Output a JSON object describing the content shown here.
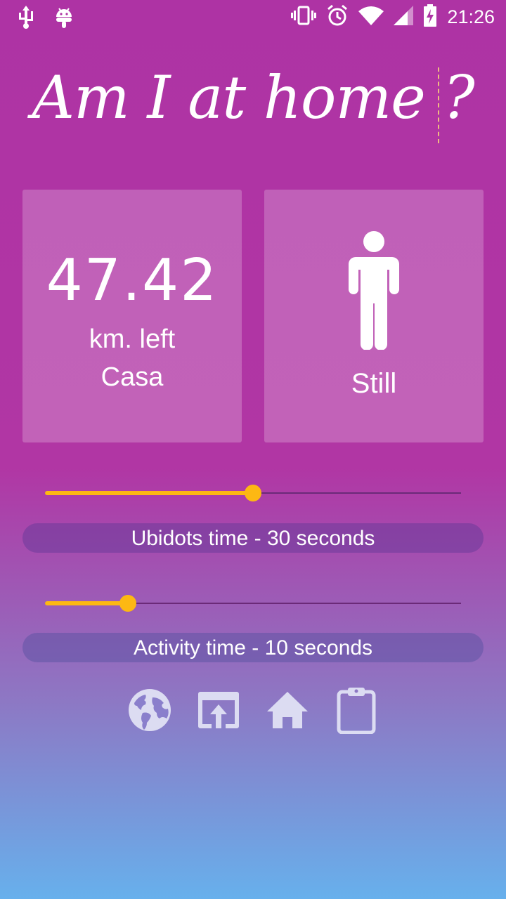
{
  "status_bar": {
    "time": "21:26",
    "left_icons": [
      "usb-icon",
      "android-icon"
    ],
    "right_icons": [
      "vibrate-icon",
      "alarm-icon",
      "wifi-icon",
      "signal-icon",
      "battery-charging-icon"
    ]
  },
  "app": {
    "title": "Am I at home ?"
  },
  "distance_card": {
    "value": "47.42",
    "unit": "km. left",
    "place": "Casa"
  },
  "activity_card": {
    "icon": "person-standing-icon",
    "label": "Still"
  },
  "sliders": {
    "ubidots": {
      "label": "Ubidots time - 30 seconds",
      "fraction": 0.5
    },
    "activity": {
      "label": "Activity time - 10 seconds",
      "fraction": 0.2
    }
  },
  "bottom_icons": [
    "globe-icon",
    "open-in-browser-icon",
    "home-icon",
    "clipboard-icon"
  ],
  "colors": {
    "accent": "#fdb813",
    "background_top": "#ae33a4",
    "background_bottom": "#67b0ec"
  }
}
